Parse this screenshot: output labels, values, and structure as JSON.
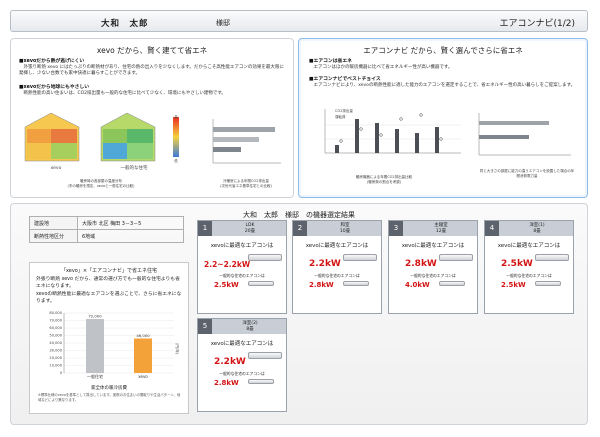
{
  "header": {
    "name": "大和　太郎",
    "sama": "様邸",
    "right_title": "エアコンナビ(1/2)"
  },
  "left_panel": {
    "title": "xevo だから、賢く建てて省エネ",
    "b1_title": "■xevoだから熱が逃げにくい",
    "b1_text": "　外張り断熱 xevo にはたっぷりの断熱材があり、住宅の熱の出入りを少なくします。だからこそ高性能エアコンの効果を最大限に発揮し、少ない台数でも家中快適に暮らすことができます。",
    "b2_title": "■xevoだから地球にもやさしい",
    "b2_text": "　断熱性能の高い住まいは、CO2排出量も一般的な住宅に比べて少なく、環境にもやさしい建物です。",
    "house1_label": "xevo",
    "house2_label": "一般的な住宅",
    "cap1": "暖房時の各部屋の温度分布",
    "cap1_sub": "(冬の暖房を想定、xevoと一般住宅の比較)",
    "cap2": "冷暖房による年間CO2排出量",
    "cap2_sub": "(次世代省エネ基準住宅との比較)",
    "legend_hi": "高",
    "legend_lo": "低"
  },
  "right_panel": {
    "title": "エアコンナビ だから、賢く選んでさらに省エネ",
    "b1_title": "■エアコンは省エネ",
    "b1_text": "　エアコンはほかの暖房機器に比べて省エネルギー性が高い機器です。",
    "b2_title": "■エアコンナビでベストチョイス",
    "b2_text": "　エアコンナビにより、xevoの断熱性能に適した能力のエアコンを選定することで、省エネルギー性の高い暮らしをご提案します。",
    "cap1": "暖房機器による年間CO2排出量比較",
    "cap1_sub": "(暖房費の割合を考慮)",
    "cap2": "同じ大きさの部屋に能力の違うエアコンを設置した場合の年間消費電力量",
    "legend1": "CO2排出量",
    "legend2": "運転費"
  },
  "result": {
    "title": "大和　太郎　様邸　の機器選定結果",
    "rows": [
      {
        "k": "建設地",
        "v": "大阪市 北区 梅田 3－3－5"
      },
      {
        "k": "断熱性地区分",
        "v": "6地域"
      }
    ],
    "intro_title": "「xevo」×「エアコンナビ」で省エネ住宅",
    "intro_text": "外張り断熱 xevo だから、通常の選び方でも一般的な住宅よりも省エネになります。",
    "intro_text2": "xevoの断熱性能に最適なエアコンを選ぶことで、さらに省エネになります。",
    "chart_caption": "家全体の暖冷房費",
    "chart_note": "※標準仕様のxevoを基準として算出しています。実際のお住まいの間取りや生活パターン、地域などにより異なります。"
  },
  "chart_data": {
    "type": "bar",
    "categories": [
      "一般住宅",
      "xevo"
    ],
    "values": [
      72000,
      46000
    ],
    "value_labels": [
      "72,000",
      "46,000"
    ],
    "ylim": [
      0,
      80000
    ],
    "yticks": [
      "0",
      "10,000",
      "20,000",
      "30,000",
      "40,000",
      "50,000",
      "60,000",
      "70,000",
      "80,000"
    ],
    "ylabel": "(円/年)"
  },
  "cards": [
    {
      "num": "1",
      "room": "LDK",
      "size": "20畳",
      "question": "xevoに最適なエアコンは",
      "kw": "2.2~2.2kW",
      "general_label": "一般的な住宅のエアコンは",
      "general": "2.5kW"
    },
    {
      "num": "2",
      "room": "和室",
      "size": "10畳",
      "question": "xevoに最適なエアコンは",
      "kw": "2.2kW",
      "general_label": "一般的な住宅のエアコンは",
      "general": "2.8kW"
    },
    {
      "num": "3",
      "room": "主寝室",
      "size": "12畳",
      "question": "xevoに最適なエアコンは",
      "kw": "2.8kW",
      "general_label": "一般的な住宅のエアコンは",
      "general": "4.0kW"
    },
    {
      "num": "4",
      "room": "洋室(1)",
      "size": "8畳",
      "question": "xevoに最適なエアコンは",
      "kw": "2.5kW",
      "general_label": "一般的な住宅のエアコンは",
      "general": "2.5kW"
    },
    {
      "num": "5",
      "room": "洋室(2)",
      "size": "8畳",
      "question": "xevoに最適なエアコンは",
      "kw": "2.2kW",
      "general_label": "一般的な住宅のエアコンは",
      "general": "2.8kW"
    }
  ],
  "colors": {
    "accent": "#d41414",
    "blue_panel": "#6aa4df",
    "orange": "#f3a23a"
  }
}
